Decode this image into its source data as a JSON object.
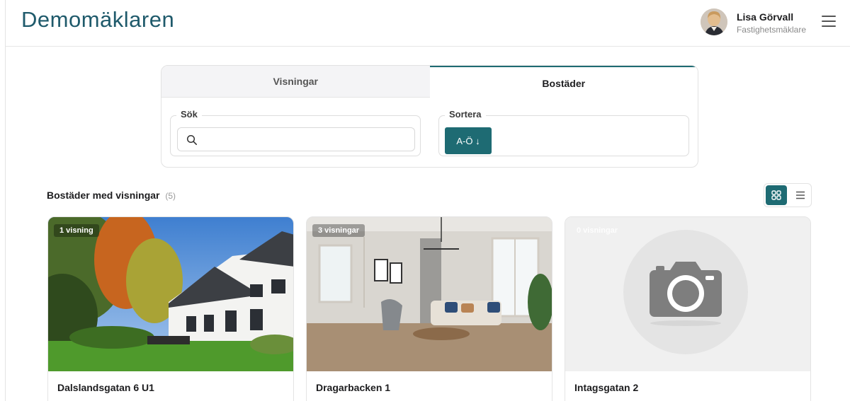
{
  "header": {
    "brand": "Demomäklaren",
    "user_name": "Lisa Görvall",
    "user_role": "Fastighetsmäklare"
  },
  "tabs": [
    {
      "label": "Visningar",
      "active": false
    },
    {
      "label": "Bostäder",
      "active": true
    }
  ],
  "filters": {
    "search_legend": "Sök",
    "search_value": "",
    "search_placeholder": "",
    "sort_legend": "Sortera",
    "sort_button": "A-Ö ↓"
  },
  "section": {
    "title": "Bostäder med visningar",
    "count": "(5)"
  },
  "view_mode": "grid",
  "cards": [
    {
      "badge": "1 visning",
      "title": "Dalslandsgatan 6 U1",
      "image": "house-photo"
    },
    {
      "badge": "3 visningar",
      "title": "Dragarbacken 1",
      "image": "living-room-photo"
    },
    {
      "badge": "0 visningar",
      "title": "Intagsgatan 2",
      "image": "camera-placeholder"
    }
  ],
  "colors": {
    "accent": "#1e6b73",
    "brand": "#1f5a6b"
  }
}
